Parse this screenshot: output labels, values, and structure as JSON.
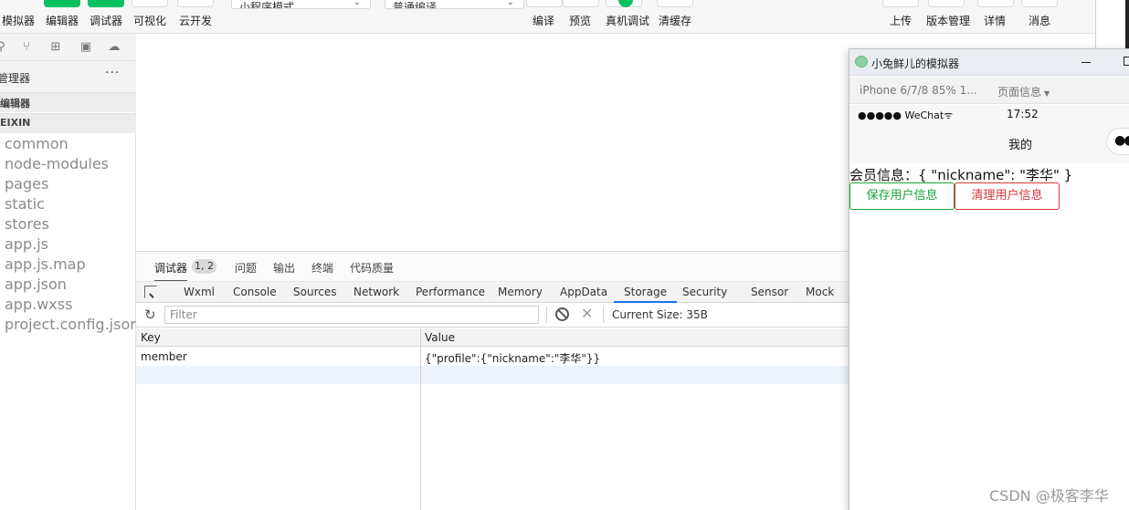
{
  "toolbar": {
    "left_buttons": [
      {
        "label": "模拟器",
        "icon": "phone-icon",
        "accent": false
      },
      {
        "label": "编辑器",
        "icon": "code-icon",
        "accent": true
      },
      {
        "label": "调试器",
        "icon": "bug-icon",
        "accent": true
      },
      {
        "label": "可视化",
        "icon": "grid-icon",
        "accent": false
      },
      {
        "label": "云开发",
        "icon": "cloud-icon",
        "accent": false
      }
    ],
    "mode_select": "小程序模式",
    "compile_select": "普通编译",
    "center_buttons": [
      {
        "label": "编译",
        "icon": "refresh-icon"
      },
      {
        "label": "预览",
        "icon": "eye-icon"
      },
      {
        "label": "真机调试",
        "icon": "check-icon"
      },
      {
        "label": "清缓存",
        "icon": "layers-icon"
      }
    ],
    "right_buttons": [
      {
        "label": "上传",
        "icon": "upload-icon"
      },
      {
        "label": "版本管理",
        "icon": "branch-icon"
      },
      {
        "label": "详情",
        "icon": "details-icon"
      },
      {
        "label": "消息",
        "icon": "bell-icon"
      }
    ]
  },
  "sidebar": {
    "explorer_title": "管理器",
    "more_label": "···",
    "section_open_editors": "编辑器",
    "section_project": "EIXIN",
    "files": [
      "common",
      "node-modules",
      "pages",
      "static",
      "stores",
      "app.js",
      "app.js.map",
      "app.json",
      "app.wxss",
      "project.config.json"
    ]
  },
  "debugger": {
    "tabs": [
      "调试器",
      "问题",
      "输出",
      "终端",
      "代码质量"
    ],
    "badge": "1, 2",
    "panel_tabs": [
      "Wxml",
      "Console",
      "Sources",
      "Network",
      "Performance",
      "Memory",
      "AppData",
      "Storage",
      "Security",
      "Sensor",
      "Mock"
    ],
    "active_panel": "Storage",
    "filter_placeholder": "Filter",
    "current_size": "Current Size: 35B",
    "columns": [
      "Key",
      "Value"
    ],
    "rows": [
      {
        "key": "member",
        "value": "{\"profile\":{\"nickname\":\"李华\"}}"
      }
    ]
  },
  "simulator": {
    "window_title": "小兔鲜儿的模拟器",
    "device_info": "iPhone 6/7/8 85% 1...",
    "page_info": "页面信息",
    "carrier": "●●●●● WeChat",
    "time": "17:52",
    "nav_title": "我的",
    "capsule_dots": "●●",
    "member_text": "会员信息：{ \"nickname\": \"李华\" }",
    "save_button": "保存用户信息",
    "clear_button": "清理用户信息"
  },
  "watermark": "CSDN @极客李华",
  "colors": {
    "brand_green": "#07c160",
    "save_green": "#19a33c",
    "clear_red": "#d8363c",
    "storage_tab_underline": "#1a73e8"
  }
}
